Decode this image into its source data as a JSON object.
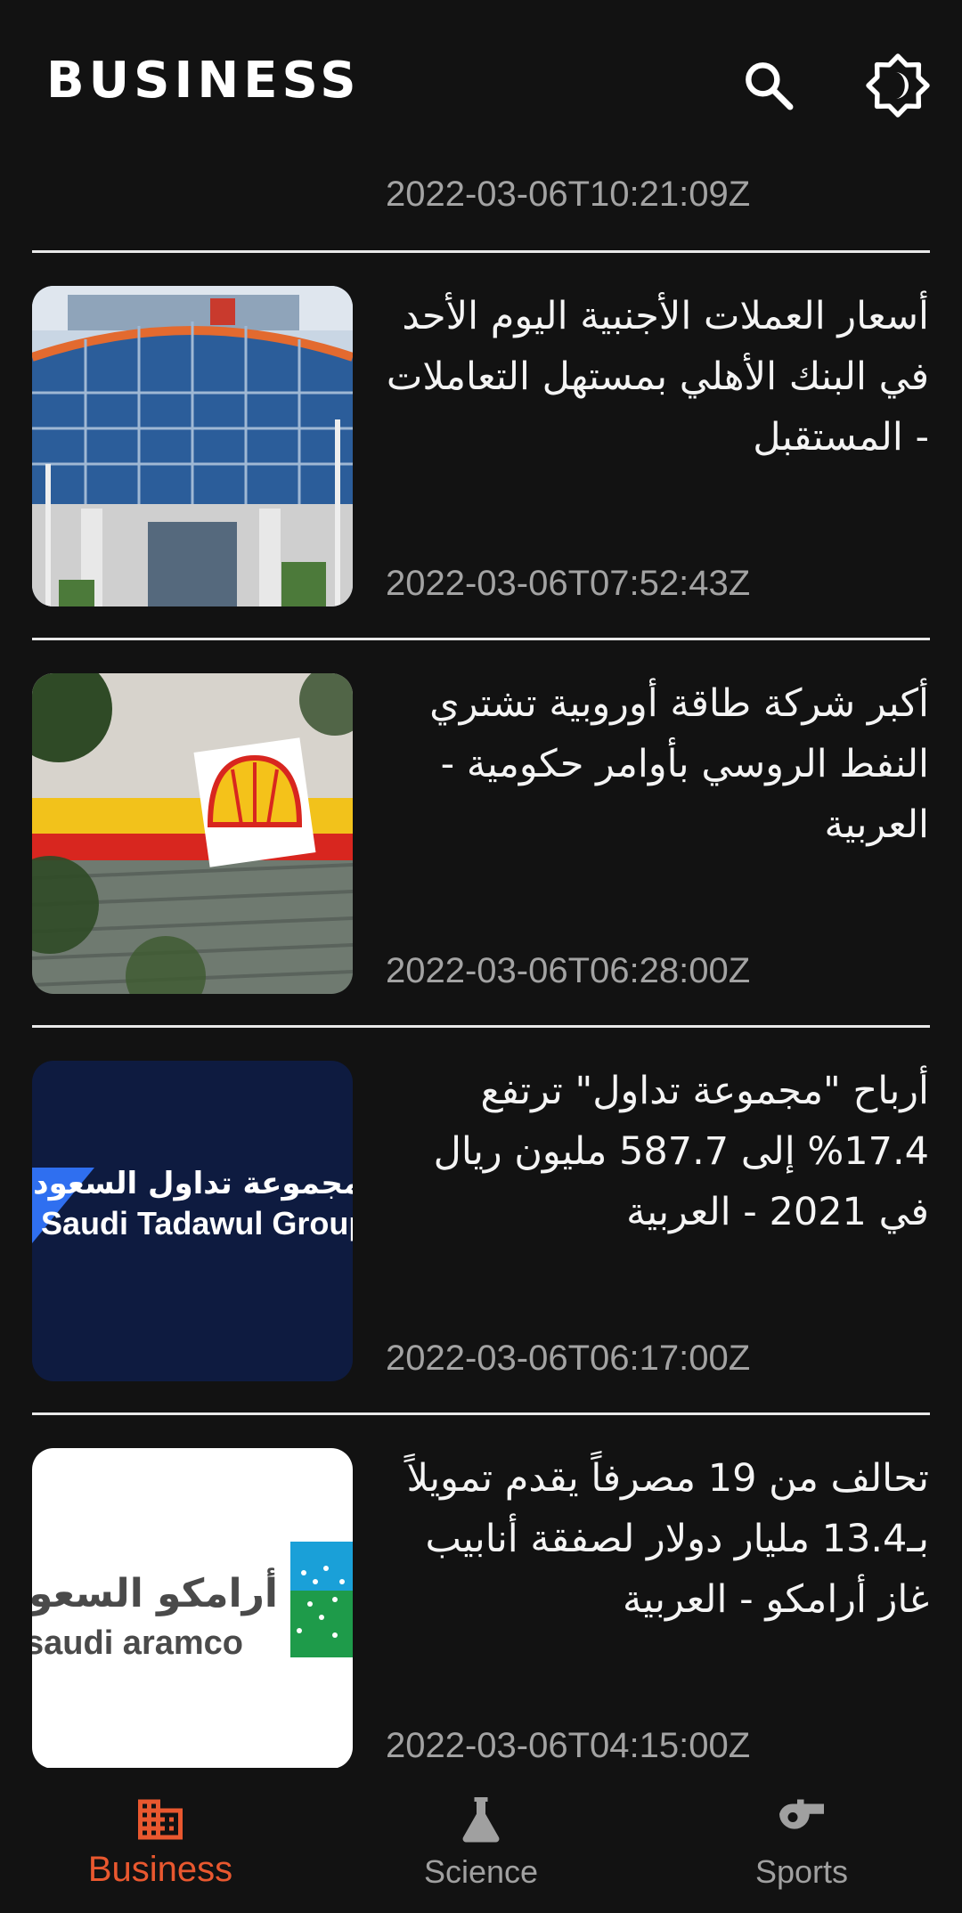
{
  "app_bar": {
    "title": "BUSINESS",
    "search_icon": "search-icon",
    "theme_icon": "brightness-toggle-icon"
  },
  "feed": {
    "partial_item_time": "2022-03-06T10:21:09Z",
    "articles": [
      {
        "title": "أسعار العملات الأجنبية اليوم الأحد في البنك الأهلي بمستهل التعاملات - المستقبل",
        "published": "2022-03-06T07:52:43Z",
        "thumbnail": "bank-building-photo"
      },
      {
        "title": "أكبر شركة طاقة أوروبية تشتري النفط الروسي بأوامر حكومية - العربية",
        "published": "2022-03-06T06:28:00Z",
        "thumbnail": "shell-station-photo"
      },
      {
        "title": "أرباح \"مجموعة تداول\" ترتفع 17.4% إلى 587.7 مليون ريال في 2021 - العربية",
        "published": "2022-03-06T06:17:00Z",
        "thumbnail": "saudi-tadawul-logo",
        "thumb_text_ar": "مجموعة تداول السعودية",
        "thumb_text_en": "Saudi Tadawul Group"
      },
      {
        "title": "تحالف من 19 مصرفاً يقدم تمويلاً بـ13.4 مليار دولار لصفقة أنابيب غاز أرامكو - العربية",
        "published": "2022-03-06T04:15:00Z",
        "thumbnail": "saudi-aramco-logo",
        "thumb_text_ar": "أرامكو السعودية",
        "thumb_text_en": "saudi aramco"
      }
    ]
  },
  "bottom_nav": {
    "items": [
      {
        "label": "Business",
        "icon": "business-building-icon",
        "active": true
      },
      {
        "label": "Science",
        "icon": "flask-icon",
        "active": false
      },
      {
        "label": "Sports",
        "icon": "whistle-icon",
        "active": false
      }
    ],
    "active_color": "#e9582f",
    "inactive_color": "#a0a0a0"
  }
}
